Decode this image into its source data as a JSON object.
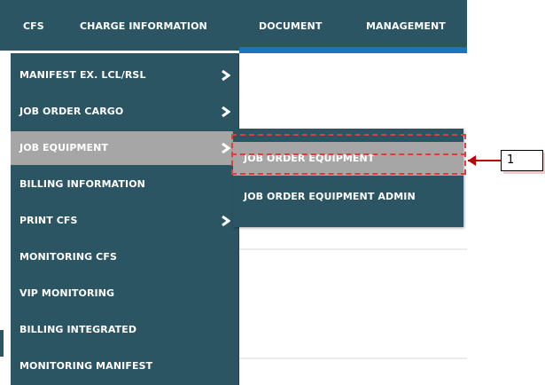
{
  "top_nav": {
    "items": [
      {
        "label": "CFS"
      },
      {
        "label": "CHARGE INFORMATION"
      },
      {
        "label": "DOCUMENT"
      },
      {
        "label": "MANAGEMENT"
      }
    ]
  },
  "cfs_menu": {
    "items": [
      {
        "label": "MANIFEST EX. LCL/RSL",
        "has_submenu": true
      },
      {
        "label": "JOB ORDER CARGO",
        "has_submenu": true
      },
      {
        "label": "JOB EQUIPMENT",
        "has_submenu": true,
        "active": true
      },
      {
        "label": "BILLING INFORMATION",
        "has_submenu": false
      },
      {
        "label": "PRINT CFS",
        "has_submenu": true
      },
      {
        "label": "MONITORING CFS",
        "has_submenu": false
      },
      {
        "label": "VIP MONITORING",
        "has_submenu": false
      },
      {
        "label": "BILLING INTEGRATED",
        "has_submenu": false
      },
      {
        "label": "MONITORING MANIFEST",
        "has_submenu": false
      }
    ]
  },
  "job_equipment_submenu": {
    "items": [
      {
        "label": "JOB ORDER EQUIPMENT",
        "active": true
      },
      {
        "label": "JOB ORDER EQUIPMENT ADMIN"
      }
    ]
  },
  "callout": {
    "number": "1"
  },
  "icons": {
    "submenu_indicator": "chevron-right-icon"
  },
  "colors": {
    "menu_bg": "#2b5563",
    "active_item_bg": "#a6a6a6",
    "accent_strip": "#1e73be",
    "callout": "#c00000",
    "highlight_border": "#e03c3c"
  }
}
